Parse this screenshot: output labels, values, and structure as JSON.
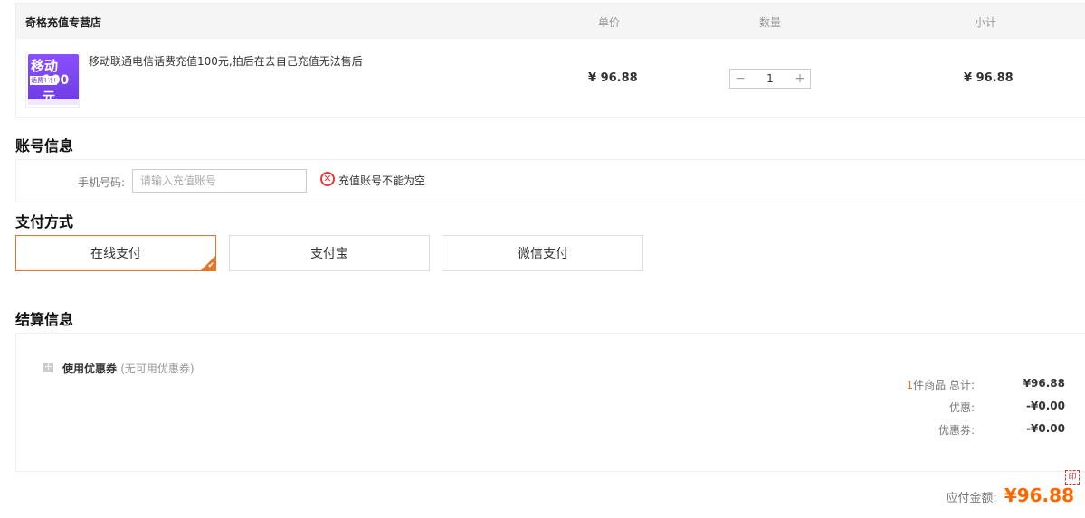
{
  "cart": {
    "shop_name": "奇格充值专营店",
    "col_price": "单价",
    "col_qty": "数量",
    "col_subtotal": "小计",
    "item": {
      "thumb_text_1": "移动",
      "thumb_text_2": "话费充值",
      "thumb_text_3": "100元",
      "title": "移动联通电信话费充值100元,拍后在去自己充值无法售后",
      "price": "¥ 96.88",
      "quantity": "1",
      "subtotal": "¥ 96.88"
    },
    "qty_minus": "−",
    "qty_plus": "+"
  },
  "account": {
    "title": "账号信息",
    "phone_label": "手机号码:",
    "phone_placeholder": "请输入充值账号",
    "error_icon": "✕",
    "error_text": "充值账号不能为空"
  },
  "payment": {
    "title": "支付方式",
    "options": [
      "在线支付",
      "支付宝",
      "微信支付"
    ],
    "selected_index": 0,
    "accent_color": "#e4762a"
  },
  "settlement": {
    "title": "结算信息",
    "coupon_label": "使用优惠券",
    "coupon_note": "(无可用优惠券)",
    "item_count": "1",
    "total_label": "件商品 总计:",
    "total_value": "¥96.88",
    "discount_label": "优惠:",
    "discount_value": "-¥0.00",
    "coupon_discount_label": "优惠券:",
    "coupon_discount_value": "-¥0.00",
    "payable_label": "应付金额:",
    "payable_value": "¥96.88",
    "payable_color": "#ff6600"
  }
}
